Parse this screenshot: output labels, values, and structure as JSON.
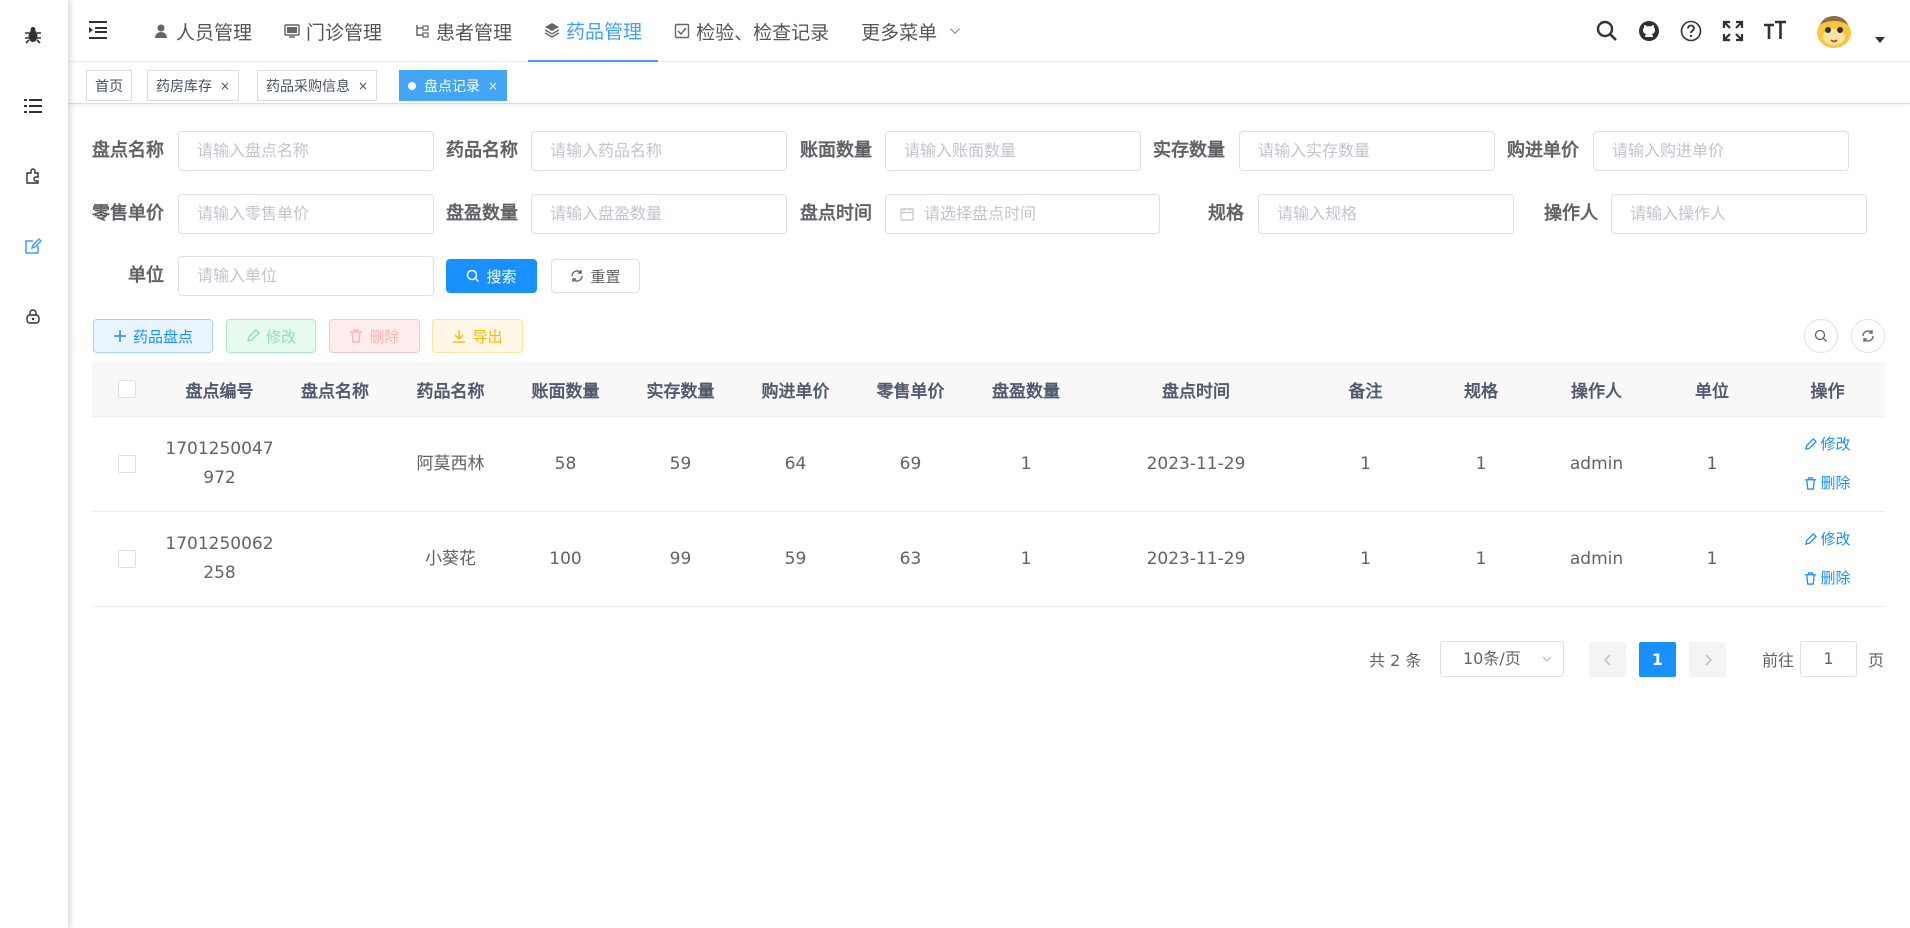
{
  "sidebar": {
    "icons": [
      "bug-icon",
      "list-icon",
      "puzzle-icon",
      "edit-icon",
      "lock-icon"
    ],
    "active_color": "#409eff"
  },
  "navbar": {
    "menu": [
      {
        "label": "人员管理",
        "icon": "user-icon"
      },
      {
        "label": "门诊管理",
        "icon": "monitor-icon"
      },
      {
        "label": "患者管理",
        "icon": "tree-icon"
      },
      {
        "label": "药品管理",
        "icon": "layers-icon"
      },
      {
        "label": "检验、检查记录",
        "icon": "checkbox-icon"
      },
      {
        "label": "更多菜单"
      }
    ],
    "active_index": 3,
    "right_icons": [
      "search-icon",
      "github-icon",
      "question-icon",
      "fullscreen-icon",
      "font-size-icon"
    ]
  },
  "tags": [
    {
      "label": "首页",
      "close": ""
    },
    {
      "label": "药房库存",
      "close": "×"
    },
    {
      "label": "药品采购信息",
      "close": "×"
    },
    {
      "label": "盘点记录",
      "close": "×",
      "active": true
    }
  ],
  "form": {
    "labels": [
      "盘点名称",
      "药品名称",
      "账面数量",
      "实存数量",
      "购进单价",
      "零售单价",
      "盘盈数量",
      "盘点时间",
      "规格",
      "操作人",
      "单位"
    ],
    "placeholders": [
      "请输入盘点名称",
      "请输入药品名称",
      "请输入账面数量",
      "请输入实存数量",
      "请输入购进单价",
      "请输入零售单价",
      "请输入盘盈数量",
      "请选择盘点时间",
      "请输入规格",
      "请输入操作人",
      "请输入单位"
    ],
    "search_label": "搜索",
    "reset_label": "重置"
  },
  "toolbar": {
    "add_label": "药品盘点",
    "edit_label": "修改",
    "delete_label": "删除",
    "export_label": "导出"
  },
  "table": {
    "columns": [
      "盘点编号",
      "盘点名称",
      "药品名称",
      "账面数量",
      "实存数量",
      "购进单价",
      "零售单价",
      "盘盈数量",
      "盘点时间",
      "备注",
      "规格",
      "操作人",
      "单位",
      "操作"
    ],
    "rows": [
      {
        "code": "1701250047972",
        "name": "",
        "drug": "阿莫西林",
        "book": "58",
        "actual": "59",
        "purchase": "64",
        "retail": "69",
        "profit": "1",
        "time": "2023-11-29",
        "remark": "1",
        "spec": "1",
        "operator": "admin",
        "unit": "1"
      },
      {
        "code": "1701250062258",
        "name": "",
        "drug": "小葵花",
        "book": "100",
        "actual": "99",
        "purchase": "59",
        "retail": "63",
        "profit": "1",
        "time": "2023-11-29",
        "remark": "1",
        "spec": "1",
        "operator": "admin",
        "unit": "1"
      }
    ],
    "op_edit": "修改",
    "op_delete": "删除"
  },
  "pagination": {
    "total_text": "共 2 条",
    "page_size": "10条/页",
    "current_page": "1",
    "goto_label": "前往",
    "goto_value": "1",
    "page_suffix": "页"
  }
}
